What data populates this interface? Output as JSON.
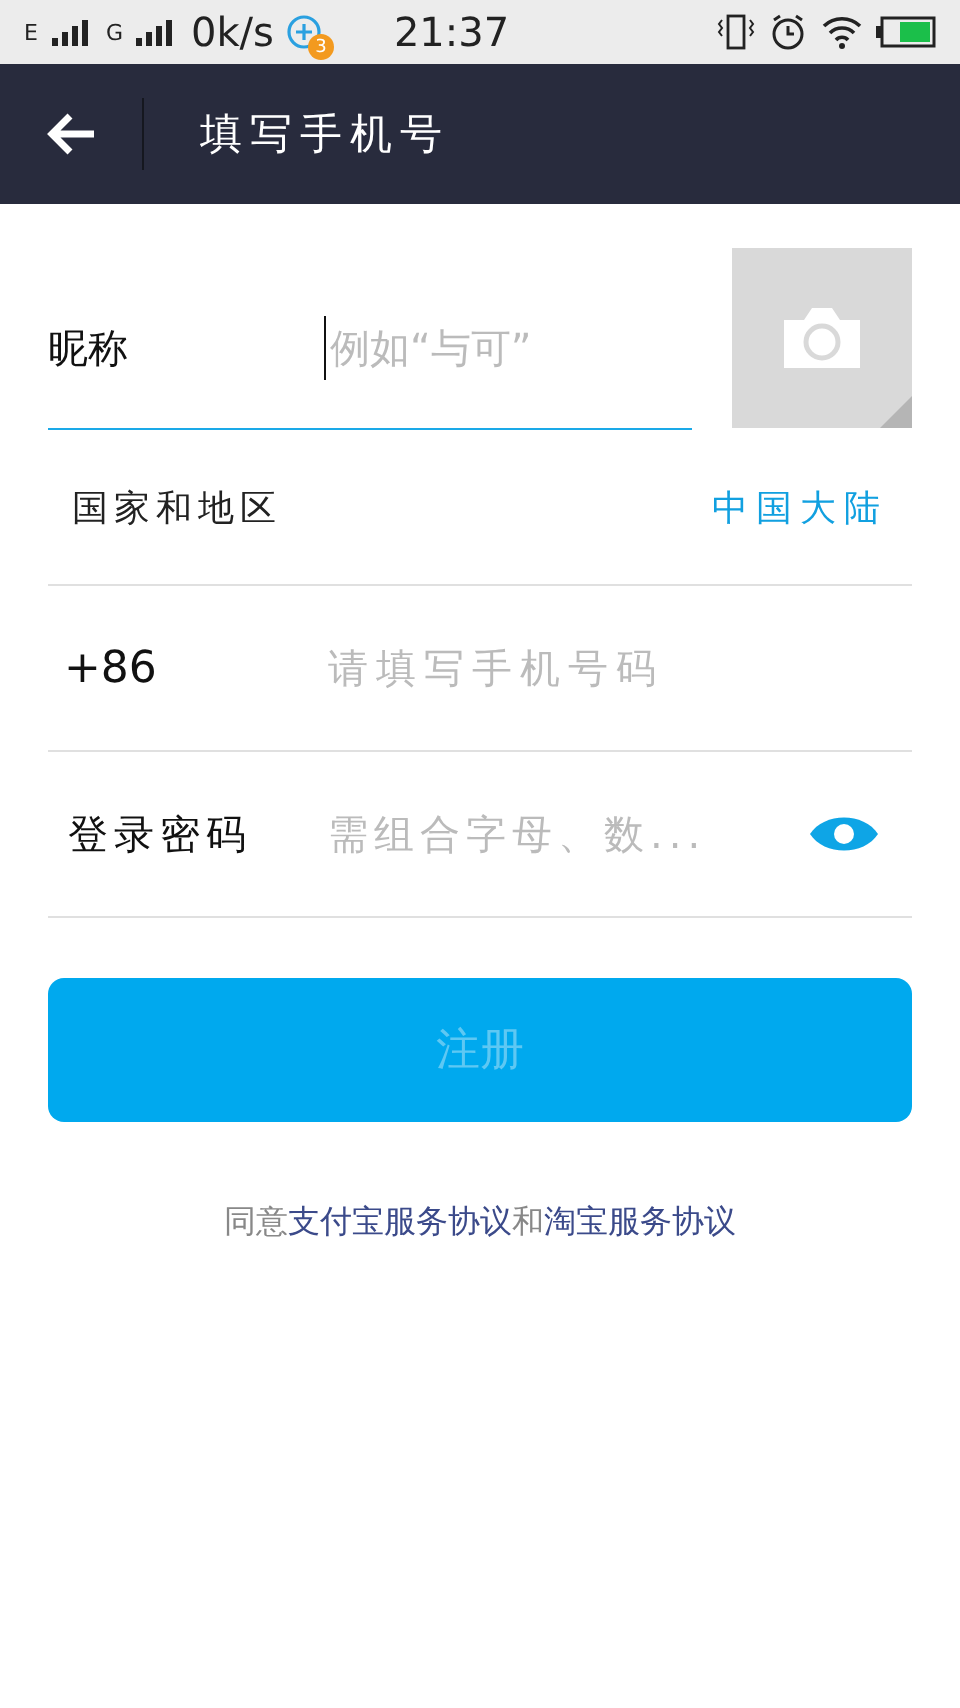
{
  "status_bar": {
    "network_1": "E",
    "network_2": "G",
    "speed": "0k/s",
    "badge": "3",
    "time": "21:37"
  },
  "header": {
    "title": "填写手机号"
  },
  "form": {
    "nickname": {
      "label": "昵称",
      "placeholder": "例如“与可”",
      "focused": true
    },
    "region": {
      "label": "国家和地区",
      "value": "中国大陆"
    },
    "phone": {
      "prefix": "+86",
      "placeholder": "请填写手机号码"
    },
    "password": {
      "label": "登录密码",
      "placeholder": "需组合字母、数...",
      "visible": true
    }
  },
  "register_button": {
    "label": "注册",
    "disabled": true
  },
  "agreement": {
    "prefix": "同意",
    "link_1": "支付宝服务协议",
    "middle": "和",
    "link_2": "淘宝服务协议"
  }
}
